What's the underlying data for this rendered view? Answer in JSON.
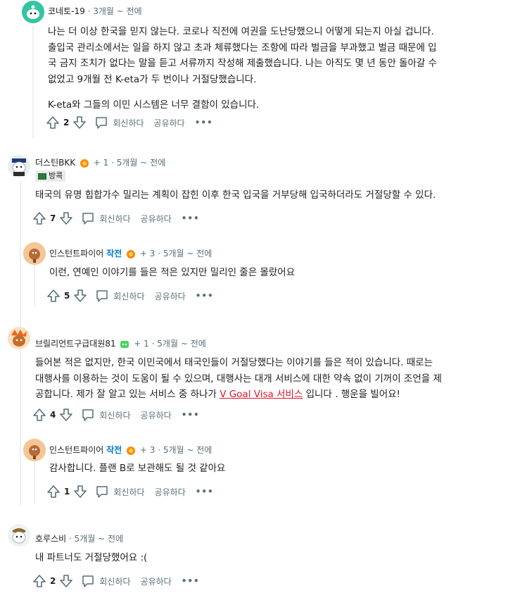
{
  "comments": [
    {
      "username": "코네토-19",
      "time": "3개월 ~ 전에",
      "paragraphs": [
        "나는 더 이상 한국을 믿지 않는다. 코로나 직전에 여권을 도난당했으니 어떻게 되는지 아실 겁니다.",
        "출입국 관리소에서는 일을 하지 않고 초과 체류했다는 조항에 따라 벌금을 부과했고 벌금 때문에 입",
        "국 금지 조치가 없다는 말을 듣고 서류까지 작성해 제출했습니다. 나는 아직도 몇 년 동안 돌아갈 수",
        "없었고 9개월 전 K-eta가 두 번이나 거절당했습니다."
      ],
      "paragraph2": "K-eta와 그들의 이민 시스템은 너무 결함이 있습니다.",
      "votes": "2"
    },
    {
      "username": "더스틴BKK",
      "awards": "+ 1",
      "time": "5개월 ~ 전에",
      "flair": "방콕",
      "text": "태국의 유명 힙합가수 밀리는 계획이 잡힌 이후 한국 입국을 거부당해 입국하더라도 거절당할 수 있다.",
      "votes": "7"
    },
    {
      "username": "인스턴트파이어",
      "op": "작전",
      "awards": "+ 3",
      "time": "5개월 ~ 전에",
      "text": "이런, 연예인 이야기를 들은 적은 있지만 밀리인 줄은 몰랐어요",
      "votes": "5"
    },
    {
      "username": "브릴리언트구급대원81",
      "awards": "+ 1",
      "time": "5개월 ~ 전에",
      "line1": "들어본 적은 없지만, 한국 이민국에서 태국인들이 거절당했다는 이야기를 들은 적이 있습니다. 때로는",
      "line2": "대행사를 이용하는 것이 도움이 될 수 있으며, 대행사는 대개 서비스에 대한 약속 없이 기꺼이 조언을 제",
      "line3_pre": "공합니다. 제가 잘 알고 있는 서비스 중 하나가 ",
      "link": "V Goal Visa 서비스",
      "line3_post": " 입니다 . 행운을 빌어요!",
      "votes": "4"
    },
    {
      "username": "인스턴트파이어",
      "op": "작전",
      "awards": "+ 3",
      "time": "5개월 ~ 전에",
      "text": "감사합니다. 플랜 B로 보관해도 될 것 같아요",
      "votes": "1"
    },
    {
      "username": "호루스비",
      "time": "5개월 ~ 전에",
      "text": "내 파트너도 거절당했어요 :(",
      "votes": "2"
    }
  ],
  "actions": {
    "reply": "회신하다",
    "share": "공유하다",
    "more": "•••"
  },
  "separator": "·"
}
